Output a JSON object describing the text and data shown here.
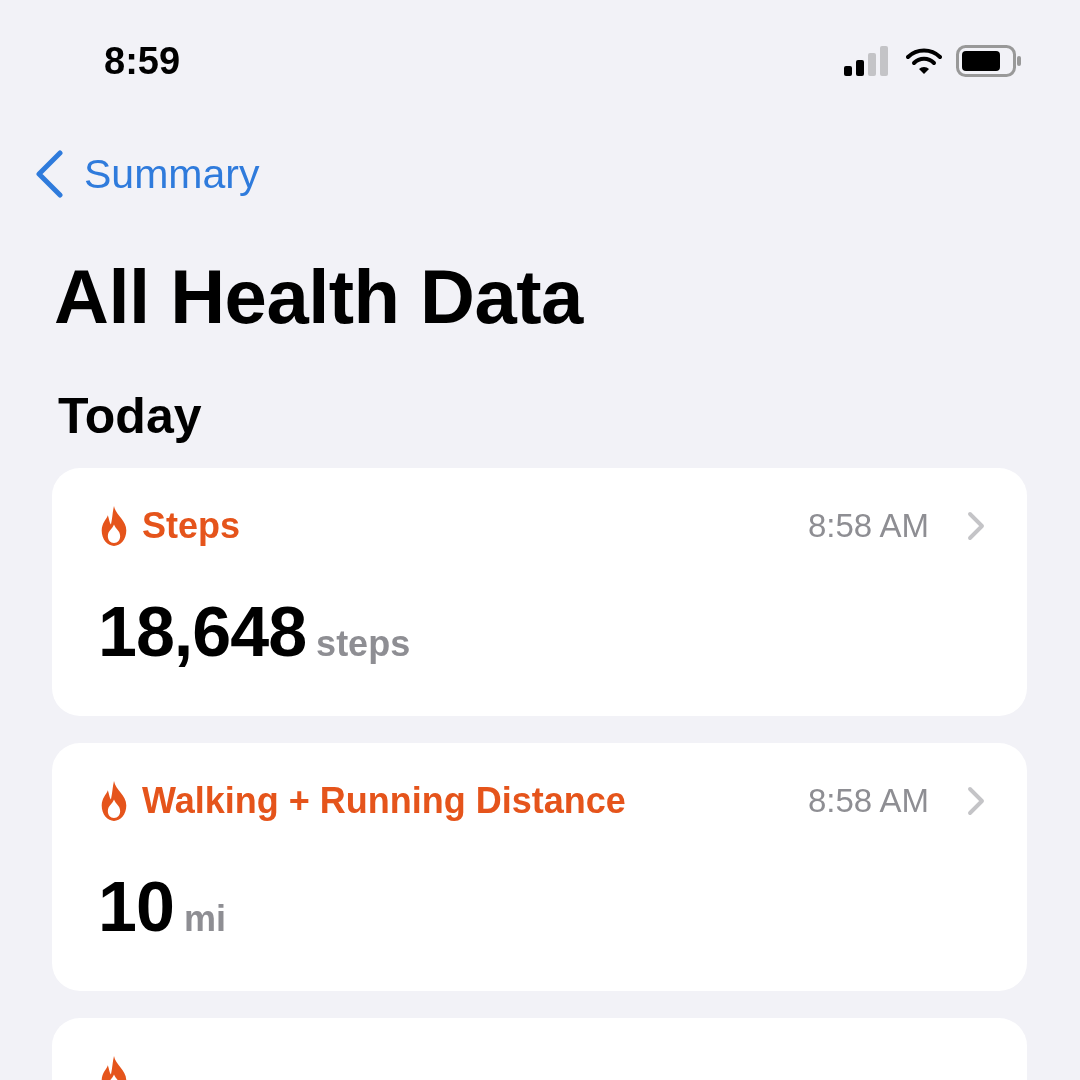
{
  "status_bar": {
    "time": "8:59"
  },
  "nav": {
    "back": "Summary"
  },
  "title": "All Health Data",
  "section": "Today",
  "cards": [
    {
      "kind": "metric",
      "title": "Steps",
      "time": "8:58 AM",
      "value": "18,648",
      "unit": "steps"
    },
    {
      "kind": "metric",
      "title": "Walking + Running Distance",
      "time": "8:58 AM",
      "value": "10",
      "unit": "mi"
    },
    {
      "kind": "partial"
    }
  ]
}
